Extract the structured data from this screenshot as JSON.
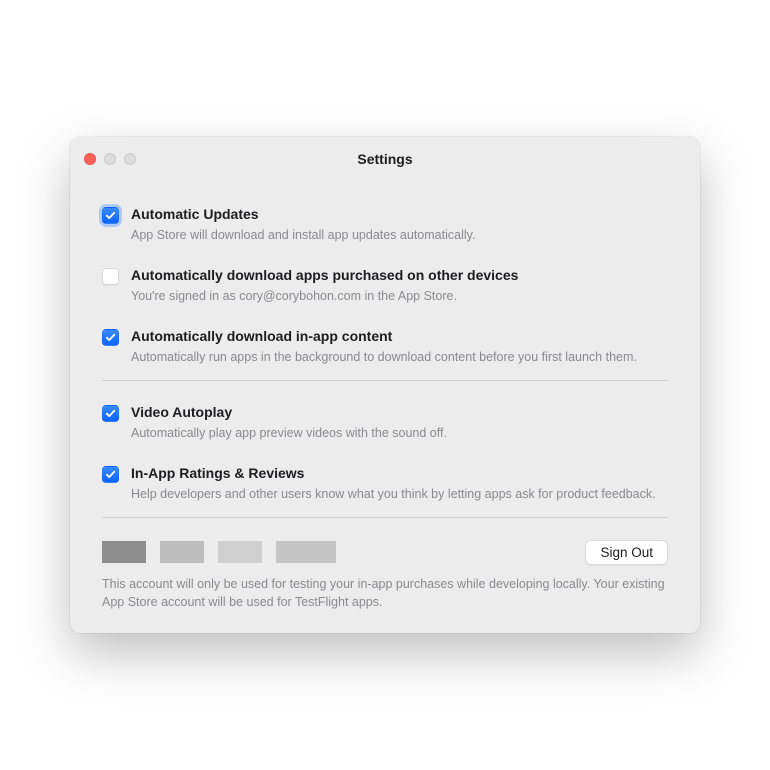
{
  "window": {
    "title": "Settings"
  },
  "settings": [
    {
      "label": "Automatic Updates",
      "desc": "App Store will download and install app updates automatically.",
      "checked": true,
      "highlighted": true
    },
    {
      "label": "Automatically download apps purchased on other devices",
      "desc": "You're signed in as cory@corybohon.com in the App Store.",
      "checked": false,
      "highlighted": false
    },
    {
      "label": "Automatically download in-app content",
      "desc": "Automatically run apps in the background to download content before you first launch them.",
      "checked": true,
      "highlighted": false
    }
  ],
  "settings2": [
    {
      "label": "Video Autoplay",
      "desc": "Automatically play app preview videos with the sound off.",
      "checked": true,
      "highlighted": false
    },
    {
      "label": "In-App Ratings & Reviews",
      "desc": "Help developers and other users know what you think by letting apps ask for product feedback.",
      "checked": true,
      "highlighted": false
    }
  ],
  "footer": {
    "sign_out_label": "Sign Out",
    "note": "This account will only be used for testing your in-app purchases while developing locally. Your existing App Store account will be used for TestFlight apps."
  }
}
